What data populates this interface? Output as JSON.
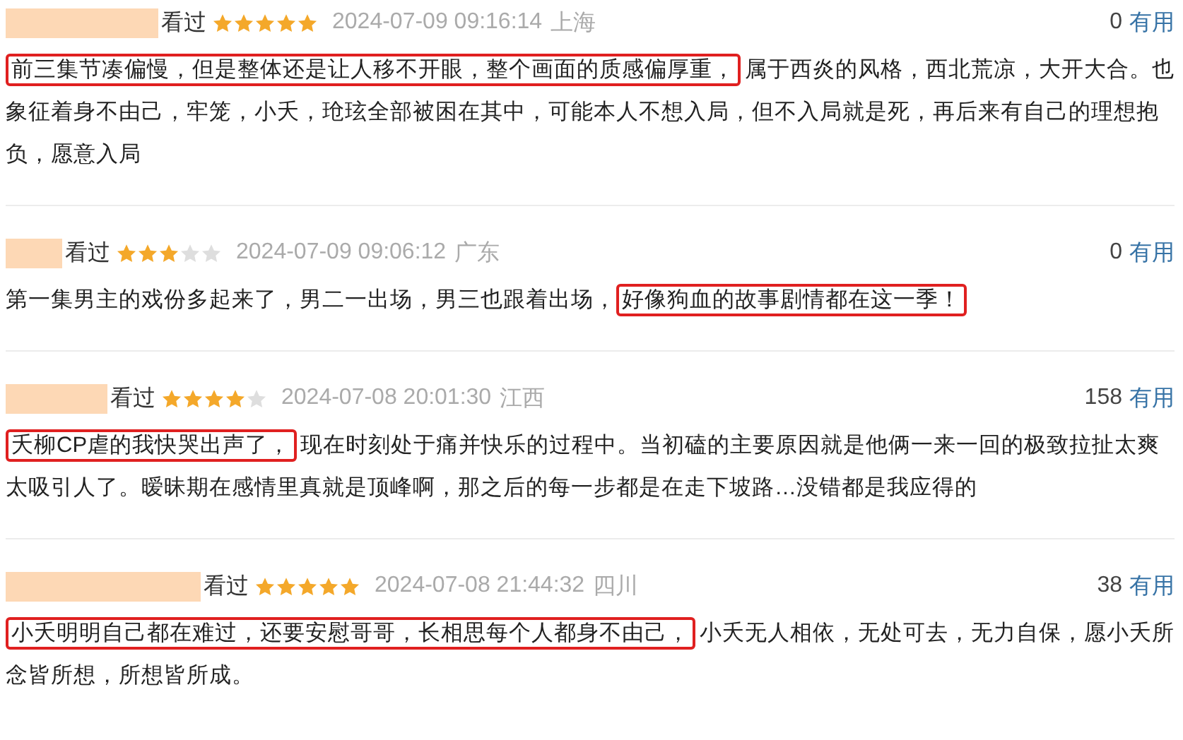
{
  "reviews": [
    {
      "status": "看过",
      "stars": 5,
      "date": "2024-07-09 09:16:14",
      "location": "上海",
      "useful_count": "0",
      "useful_label": "有用",
      "body": [
        {
          "text": "前三集节凑偏慢，但是整体还是让人移不开眼，整个画面的质感偏厚重，",
          "boxed": true
        },
        {
          "text": "属于西炎的风格，西北荒凉，大开大合。也象征着身不由己，牢笼，小夭，玱玹全部被困在其中，可能本人不想入局，但不入局就是死，再后来有自己的理想抱负，愿意入局",
          "boxed": false
        }
      ]
    },
    {
      "status": "看过",
      "stars": 3,
      "date": "2024-07-09 09:06:12",
      "location": "广东",
      "useful_count": "0",
      "useful_label": "有用",
      "body": [
        {
          "text": "第一集男主的戏份多起来了，男二一出场，男三也跟着出场，",
          "boxed": false
        },
        {
          "text": "好像狗血的故事剧情都在这一季！",
          "boxed": true
        }
      ]
    },
    {
      "status": "看过",
      "stars": 4,
      "date": "2024-07-08 20:01:30",
      "location": "江西",
      "useful_count": "158",
      "useful_label": "有用",
      "body": [
        {
          "text": "夭柳CP虐的我快哭出声了，",
          "boxed": true
        },
        {
          "text": "现在时刻处于痛并快乐的过程中。当初磕的主要原因就是他俩一来一回的极致拉扯太爽太吸引人了。暧昧期在感情里真就是顶峰啊，那之后的每一步都是在走下坡路…没错都是我应得的",
          "boxed": false
        }
      ]
    },
    {
      "status": "看过",
      "stars": 5,
      "date": "2024-07-08 21:44:32",
      "location": "四川",
      "useful_count": "38",
      "useful_label": "有用",
      "body": [
        {
          "text": "小夭明明自己都在难过，还要安慰哥哥，长相思每个人都身不由己，",
          "boxed": true
        },
        {
          "text": "小夭无人相依，无处可去，无力自保，愿小夭所念皆所想，所想皆所成。",
          "boxed": false
        }
      ]
    }
  ]
}
